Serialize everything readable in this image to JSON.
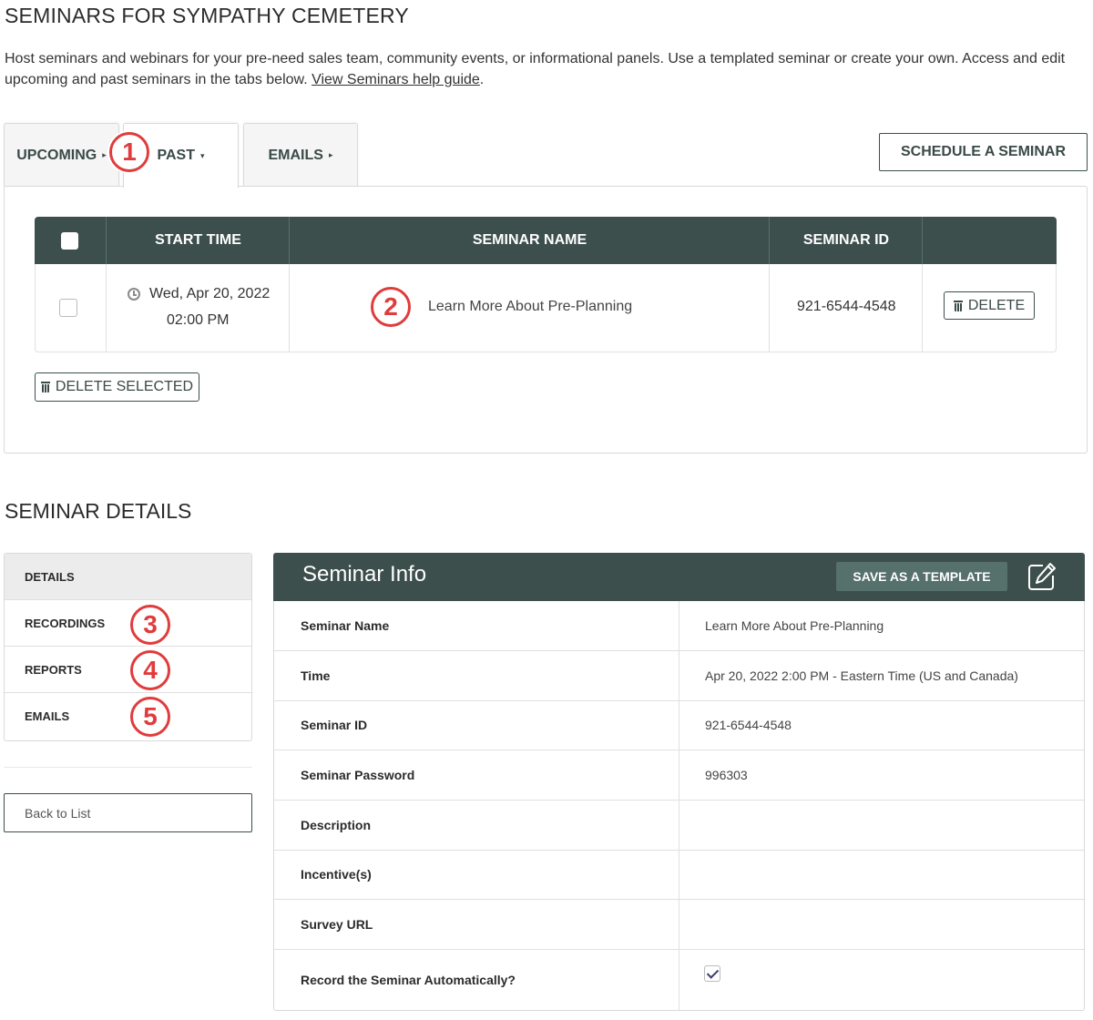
{
  "page": {
    "title": "SEMINARS FOR SYMPATHY CEMETERY",
    "intro_text": "Host seminars and webinars for your pre-need sales team, community events, or informational panels. Use a templated seminar or create your own. Access and edit upcoming and past seminars in the tabs below. ",
    "help_link": "View Seminars help guide",
    "intro_end": "."
  },
  "tabs": [
    {
      "label": "UPCOMING",
      "caret": "▸"
    },
    {
      "label": "PAST",
      "caret": "▾"
    },
    {
      "label": "EMAILS",
      "caret": "▸"
    }
  ],
  "schedule_button": "SCHEDULE A SEMINAR",
  "table": {
    "headers": [
      "START TIME",
      "SEMINAR NAME",
      "SEMINAR ID"
    ],
    "rows": [
      {
        "date": "Wed, Apr 20, 2022",
        "time": "02:00 PM",
        "name": "Learn More About Pre-Planning",
        "id": "921-6544-4548",
        "delete": "DELETE"
      }
    ],
    "delete_selected": "DELETE SELECTED"
  },
  "badges": [
    "1",
    "2",
    "3",
    "4",
    "5"
  ],
  "details": {
    "title": "SEMINAR DETAILS",
    "nav": [
      "DETAILS",
      "RECORDINGS",
      "REPORTS",
      "EMAILS"
    ],
    "back": "Back to List"
  },
  "info": {
    "title": "Seminar Info",
    "save_template": "SAVE AS A TEMPLATE",
    "rows": [
      {
        "label": "Seminar Name",
        "value": "Learn More About Pre-Planning"
      },
      {
        "label": "Time",
        "value": "Apr 20, 2022 2:00 PM - Eastern Time (US and Canada)"
      },
      {
        "label": "Seminar ID",
        "value": "921-6544-4548"
      },
      {
        "label": "Seminar Password",
        "value": "996303"
      },
      {
        "label": "Description",
        "value": ""
      },
      {
        "label": "Incentive(s)",
        "value": ""
      },
      {
        "label": "Survey URL",
        "value": ""
      },
      {
        "label": "Record the Seminar Automatically?",
        "value": ""
      }
    ],
    "record_auto_checked": true
  },
  "colors": {
    "header": "#3d4f4c",
    "badge": "#e03c3c",
    "button_secondary": "#56706b"
  },
  "icons": [
    "clock-icon",
    "trash-icon",
    "edit-icon",
    "checkbox-icon",
    "caret-icon"
  ]
}
